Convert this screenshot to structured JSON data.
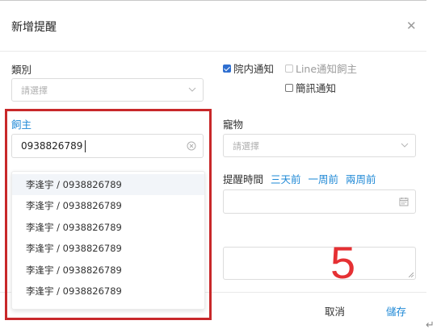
{
  "dialog": {
    "title": "新增提醒"
  },
  "category": {
    "label": "類別",
    "placeholder": "請選擇"
  },
  "notify": {
    "in_hospital": "院内通知",
    "line_owner": "Line通知飼主",
    "sms": "簡訊通知"
  },
  "owner": {
    "label": "飼主",
    "value": "0938826789",
    "options": [
      "李逢宇 / 0938826789",
      "李逢宇 / 0938826789",
      "李逢宇 / 0938826789",
      "李逢宇 / 0938826789",
      "李逢宇 / 0938826789",
      "李逢宇 / 0938826789"
    ]
  },
  "pet": {
    "label": "寵物",
    "placeholder": "請選擇"
  },
  "reminder_time": {
    "label": "提醒時間",
    "quick": [
      "三天前",
      "一周前",
      "兩周前"
    ]
  },
  "footer": {
    "cancel": "取消",
    "save": "儲存"
  },
  "annotation": {
    "step": "5",
    "return_mark": "↵"
  }
}
